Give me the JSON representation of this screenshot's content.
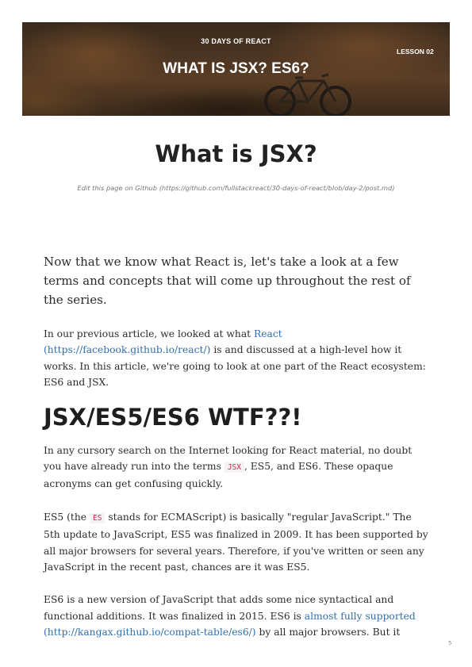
{
  "banner": {
    "kicker": "30 DAYS OF REACT",
    "title": "WHAT IS JSX? ES6?",
    "lesson": "LESSON 02"
  },
  "page": {
    "title": "What is JSX?",
    "edit_link": "Edit this page on Github (https://github.com/fullstackreact/30-days-of-react/blob/day-2/post.md)",
    "page_number": "5"
  },
  "content": {
    "lead": "Now that we know what React is, let's take a look at a few terms and concepts that will come up throughout the rest of the series.",
    "p1": {
      "before": "In our previous article, we looked at what ",
      "link": "React (https://facebook.github.io/react/)",
      "after": " is and discussed at a high-level how it works. In this article, we're going to look at one part of the React ecosystem: ES6 and JSX."
    },
    "heading": "JSX/ES5/ES6 WTF??!",
    "p2": {
      "before": "In any cursory search on the Internet looking for React material, no doubt you have already run into the terms ",
      "code": "JSX",
      "after": ", ES5, and ES6. These opaque acronyms can get confusing quickly."
    },
    "p3": {
      "before": "ES5 (the ",
      "code": "ES",
      "after": " stands for ECMAScript) is basically \"regular JavaScript.\" The 5th update to JavaScript, ES5 was finalized in 2009. It has been supported by all major browsers for several years. Therefore, if you've written or seen any JavaScript in the recent past, chances are it was ES5."
    },
    "p4": {
      "before": "ES6 is a new version of JavaScript that adds some nice syntactical and functional additions. It was finalized in 2015. ES6 is ",
      "link": "almost fully supported (http://kangax.github.io/compat-table/es6/)",
      "after": " by all major browsers. But it"
    }
  }
}
